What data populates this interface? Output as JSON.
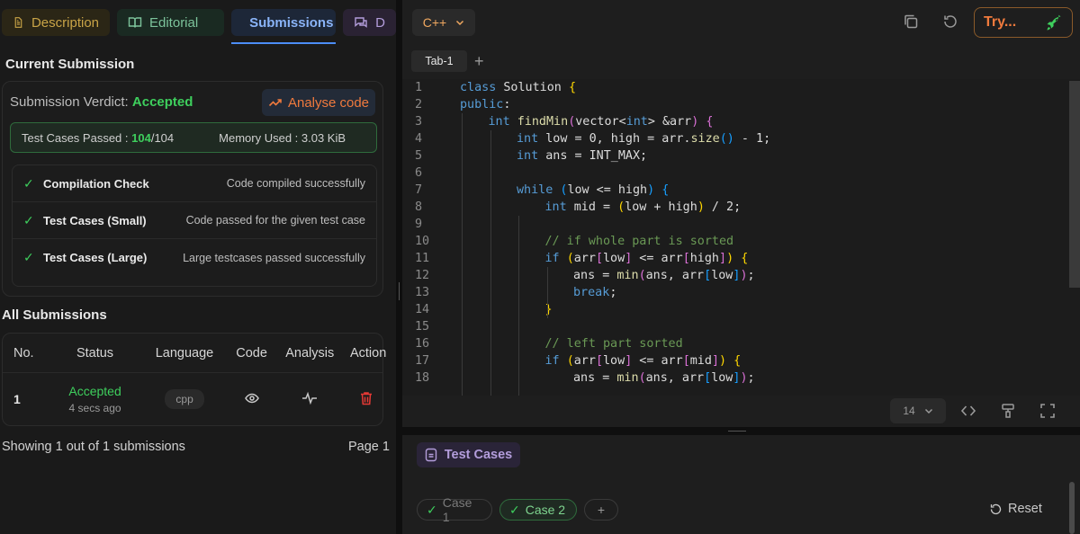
{
  "tabs": {
    "description": "Description",
    "editorial": "Editorial",
    "submissions": "Submissions",
    "discuss": "D"
  },
  "current_submission": {
    "title": "Current Submission",
    "verdict_label": "Submission Verdict:",
    "verdict_value": "Accepted",
    "analyse_label": "Analyse code",
    "tc_label": "Test Cases Passed :",
    "tc_passed": "104",
    "tc_total": "/104",
    "memory_label": "Memory Used : 3.03 KiB",
    "checks": [
      {
        "name": "Compilation Check",
        "message": "Code compiled successfully"
      },
      {
        "name": "Test Cases (Small)",
        "message": "Code passed for the given test case"
      },
      {
        "name": "Test Cases (Large)",
        "message": "Large testcases passed successfully"
      }
    ]
  },
  "all_submissions": {
    "title": "All Submissions",
    "columns": [
      "No.",
      "Status",
      "Language",
      "Code",
      "Analysis",
      "Action"
    ],
    "rows": [
      {
        "no": "1",
        "status": "Accepted",
        "time": "4 secs ago",
        "language": "cpp"
      }
    ],
    "showing": "Showing 1 out of 1 submissions",
    "page": "Page 1"
  },
  "editor": {
    "language": "C++",
    "try_label": "Try...",
    "file_tab": "Tab-1",
    "font_size": "14",
    "lines": [
      {
        "n": "1",
        "indent": 0,
        "html": "<span class=\"kw\">class</span> Solution <span class=\"br1\">{</span>"
      },
      {
        "n": "2",
        "indent": 0,
        "html": "<span class=\"kw\">public</span>:"
      },
      {
        "n": "3",
        "indent": 1,
        "html": "<span class=\"kw\">int</span> <span class=\"fn\">findMin</span><span class=\"br2\">(</span>vector&lt;<span class=\"kw\">int</span>&gt; &amp;arr<span class=\"br2\">)</span> <span class=\"br2\">{</span>"
      },
      {
        "n": "4",
        "indent": 2,
        "html": "<span class=\"kw\">int</span> low = 0, high = arr.<span class=\"fn\">size</span><span class=\"br3\">()</span> - 1;"
      },
      {
        "n": "5",
        "indent": 2,
        "html": "<span class=\"kw\">int</span> ans = INT_MAX;"
      },
      {
        "n": "6",
        "indent": 2,
        "html": ""
      },
      {
        "n": "7",
        "indent": 2,
        "html": "<span class=\"kw\">while</span> <span class=\"br3\">(</span>low &lt;= high<span class=\"br3\">)</span> <span class=\"br3\">{</span>"
      },
      {
        "n": "8",
        "indent": 3,
        "html": "<span class=\"kw\">int</span> mid = <span class=\"br1\">(</span>low + high<span class=\"br1\">)</span> / 2;"
      },
      {
        "n": "9",
        "indent": 3,
        "html": ""
      },
      {
        "n": "10",
        "indent": 3,
        "html": "<span class=\"cm\">// if whole part is sorted</span>"
      },
      {
        "n": "11",
        "indent": 3,
        "html": "<span class=\"kw\">if</span> <span class=\"br1\">(</span>arr<span class=\"br2\">[</span>low<span class=\"br2\">]</span> &lt;= arr<span class=\"br2\">[</span>high<span class=\"br2\">]</span><span class=\"br1\">)</span> <span class=\"br1\">{</span>"
      },
      {
        "n": "12",
        "indent": 4,
        "html": "ans = <span class=\"fn\">min</span><span class=\"br2\">(</span>ans, arr<span class=\"br3\">[</span>low<span class=\"br3\">]</span><span class=\"br2\">)</span>;"
      },
      {
        "n": "13",
        "indent": 4,
        "html": "<span class=\"kw\">break</span>;"
      },
      {
        "n": "14",
        "indent": 3,
        "html": "<span class=\"br1\">}</span>"
      },
      {
        "n": "15",
        "indent": 3,
        "html": ""
      },
      {
        "n": "16",
        "indent": 3,
        "html": "<span class=\"cm\">// left part sorted</span>"
      },
      {
        "n": "17",
        "indent": 3,
        "html": "<span class=\"kw\">if</span> <span class=\"br1\">(</span>arr<span class=\"br2\">[</span>low<span class=\"br2\">]</span> &lt;= arr<span class=\"br2\">[</span>mid<span class=\"br2\">]</span><span class=\"br1\">)</span> <span class=\"br1\">{</span>"
      },
      {
        "n": "18",
        "indent": 4,
        "html": "ans = <span class=\"fn\">min</span><span class=\"br2\">(</span>ans, arr<span class=\"br3\">[</span>low<span class=\"br3\">]</span><span class=\"br2\">)</span>;"
      }
    ]
  },
  "bottom": {
    "tab_label": "Test Cases",
    "case1": "Case 1",
    "case2": "Case 2",
    "reset": "Reset"
  },
  "colors": {
    "accent_green": "#3ecf5d",
    "accent_orange": "#f07a3d",
    "accent_blue": "#8ab4f8"
  }
}
